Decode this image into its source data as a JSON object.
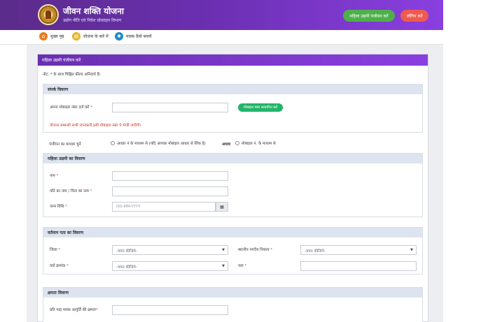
{
  "header": {
    "title": "जीवन शक्ति योजना",
    "subtitle": "उद्योग नीति एवं निवेश प्रोत्साहन विभाग",
    "register_button": "महिला उद्यमी पंजीयन करें",
    "login_button": "लॉगिन करें",
    "colors": {
      "primary": "#6a2fb0",
      "register": "#4eb04a",
      "login": "#ef5a50"
    }
  },
  "nav": {
    "items": [
      {
        "label": "मुख्य पृष्ठ",
        "icon": "home-icon",
        "color": "#e67e22"
      },
      {
        "label": "योजना के बारे में",
        "icon": "document-icon",
        "color": "#e6b422"
      },
      {
        "label": "मास्क कैसे बनायें",
        "icon": "gear-icon",
        "color": "#1e88c8"
      }
    ]
  },
  "form": {
    "title": "महिला उद्यमी पंजीयन करें",
    "note": "नोट: * के साथ चिह्नित फ़ील्ड अनिवार्य हैं।",
    "contact": {
      "heading": "संपर्क विवरण",
      "mobile_label": "अपना मोबाइल नंबर दर्ज करें",
      "mobile_value": "",
      "verify_button": "मोबाइल नंबर सत्यापित करें",
      "info": "योजना सम्बन्धी सभी जानकारी इसी मोबाइल नंबर पे भेजी जाएँगी।"
    },
    "registration": {
      "label": "पंजीयन का माध्यम चुनें",
      "option_aadhaar": "आधार नं के माध्यम से (यदि आपका मोबाइल आधार से लिंक है)",
      "or": "अथवा",
      "option_mobile": "मोबाइल नं. के माध्यम से"
    },
    "entrepreneur": {
      "heading": "महिला उद्यमी का विवरण",
      "name_label": "नाम",
      "name_value": "",
      "father_label": "पति का नाम / पिता का नाम",
      "father_value": "",
      "dob_label": "जन्म तिथि",
      "dob_placeholder": "DD-MM-YYYY"
    },
    "address": {
      "heading": "वर्तमान पता का विवरण",
      "district_label": "जिला",
      "district_value": "-चयन कीजिये-",
      "body_label": "स्थानीय नगरीय निकाय",
      "body_value": "-चयन कीजिये-",
      "ward_label": "वार्ड क्रमांक",
      "ward_value": "-चयन कीजिये-",
      "address_label": "पता",
      "address_value": ""
    },
    "capacity": {
      "heading": "क्षमता विवरण",
      "monthly_label": "प्रति माह मास्क आपूर्ति की क्षमता",
      "monthly_value": ""
    }
  }
}
